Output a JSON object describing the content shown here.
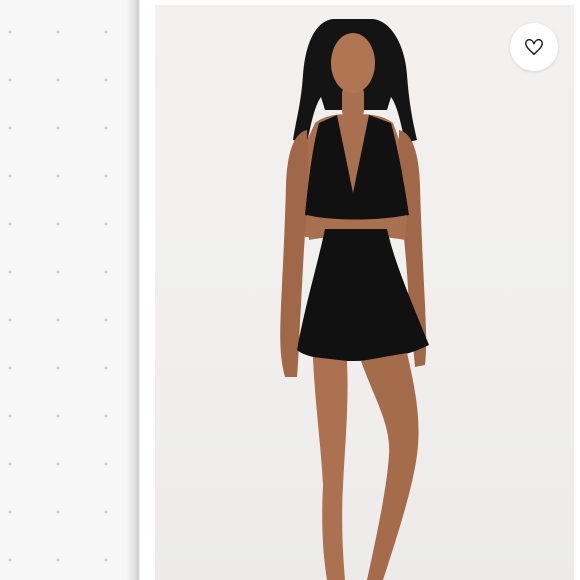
{
  "colors": {
    "background": "#ffffff",
    "left_panel": "#f7f7f7",
    "product_bg": "#f0efed",
    "garment": "#111111",
    "skin": "#a9704f",
    "wishlist_bg": "#ffffff"
  },
  "icons": {
    "wishlist": "heart-outline-icon"
  }
}
